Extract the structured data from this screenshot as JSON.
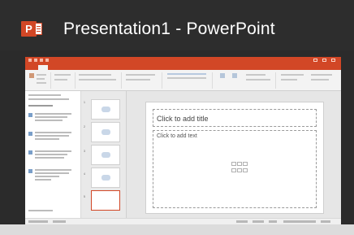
{
  "header": {
    "app_icon_letter": "P",
    "title": "Presentation1 - PowerPoint"
  },
  "slide": {
    "title_placeholder": "Click to add title",
    "body_placeholder": "Click to add text"
  },
  "thumbnails": {
    "count": 5,
    "selected_index": 5
  },
  "colors": {
    "brand": "#d24726",
    "header_bg": "#2d2d2d"
  },
  "icons": [
    "powerpoint-logo-icon",
    "content-placeholder-icons"
  ]
}
